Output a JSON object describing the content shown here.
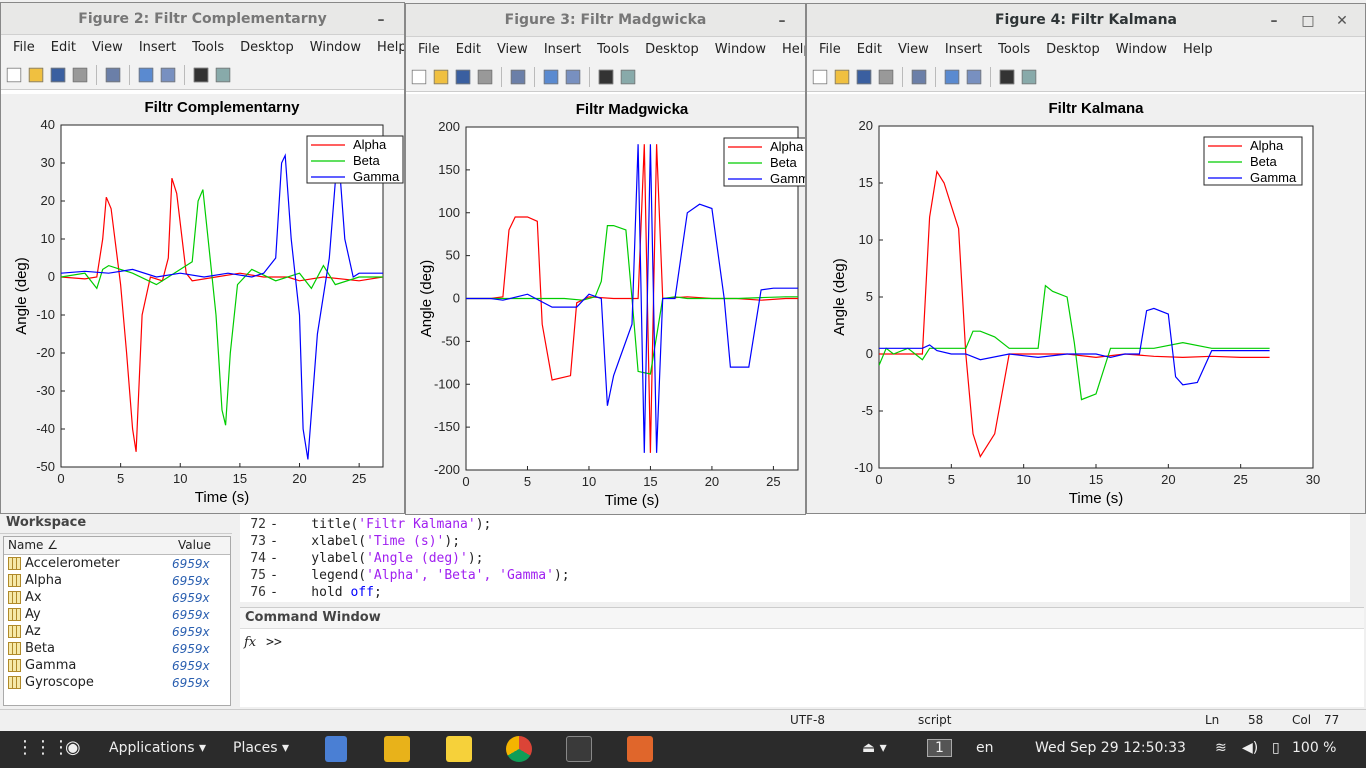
{
  "figures": [
    {
      "id": "fig2",
      "window_title": "Figure 2: Filtr Complementarny",
      "menu": [
        "File",
        "Edit",
        "View",
        "Insert",
        "Tools",
        "Desktop",
        "Window",
        "Help"
      ],
      "chart_data": {
        "type": "line",
        "title": "Filtr Complementarny",
        "xlabel": "Time (s)",
        "ylabel": "Angle (deg)",
        "xlim": [
          0,
          27
        ],
        "ylim": [
          -50,
          40
        ],
        "xticks": [
          0,
          5,
          10,
          15,
          20,
          25
        ],
        "yticks": [
          40,
          30,
          20,
          10,
          0,
          -10,
          -20,
          -30,
          -40,
          -50
        ],
        "legend": "top-right",
        "series": [
          {
            "name": "Alpha",
            "color": "#ff0000",
            "x": [
              0,
              2,
              3,
              3.5,
              3.8,
              4.2,
              5,
              5.5,
              6,
              6.3,
              6.8,
              7.5,
              8.5,
              9,
              9.3,
              9.7,
              10.5,
              11,
              13,
              15,
              17,
              19,
              20,
              22,
              25,
              27
            ],
            "y": [
              0,
              -0.5,
              0,
              10,
              21,
              18,
              -2,
              -20,
              -40,
              -46,
              -10,
              0,
              -1,
              5,
              26,
              22,
              1,
              -1,
              0,
              1,
              0,
              0,
              -1,
              0,
              -1,
              0
            ]
          },
          {
            "name": "Beta",
            "color": "#00cc00",
            "x": [
              0,
              2,
              3,
              3.5,
              4,
              5,
              6,
              8,
              10,
              11,
              11.5,
              11.9,
              12.5,
              13,
              13.5,
              13.8,
              14.2,
              14.8,
              16,
              18,
              20,
              21,
              22,
              23,
              25,
              27
            ],
            "y": [
              0,
              1,
              -3,
              2,
              3,
              2,
              1,
              -2,
              2,
              4,
              20,
              23,
              5,
              -10,
              -35,
              -39,
              -20,
              -2,
              2,
              -1,
              1,
              -3,
              3,
              -2,
              0,
              0
            ]
          },
          {
            "name": "Gamma",
            "color": "#0000ff",
            "x": [
              0,
              2,
              4,
              6,
              8,
              10,
              12,
              14,
              16,
              17,
              18,
              18.5,
              18.8,
              19.3,
              20,
              20.3,
              20.7,
              21.5,
              22.5,
              23,
              23.3,
              23.8,
              24.5,
              25,
              27
            ],
            "y": [
              1,
              1.5,
              1,
              2,
              0,
              1,
              0,
              1,
              0,
              1,
              5,
              30,
              32,
              10,
              -10,
              -40,
              -48,
              -15,
              5,
              25,
              31,
              10,
              0,
              1,
              1
            ]
          }
        ]
      }
    },
    {
      "id": "fig3",
      "window_title": "Figure 3: Filtr Madgwicka",
      "menu": [
        "File",
        "Edit",
        "View",
        "Insert",
        "Tools",
        "Desktop",
        "Window",
        "Help"
      ],
      "chart_data": {
        "type": "line",
        "title": "Filtr Madgwicka",
        "xlabel": "Time (s)",
        "ylabel": "Angle (deg)",
        "xlim": [
          0,
          27
        ],
        "ylim": [
          -200,
          200
        ],
        "xticks": [
          0,
          5,
          10,
          15,
          20,
          25
        ],
        "yticks": [
          200,
          150,
          100,
          50,
          0,
          -50,
          -100,
          -150,
          -200
        ],
        "legend": "top-right",
        "series": [
          {
            "name": "Alpha",
            "color": "#ff0000",
            "x": [
              0,
              2,
              3,
              3.5,
              4,
              5,
              5.8,
              6.2,
              7,
              8.5,
              9,
              10,
              12,
              14,
              14.5,
              15,
              15.5,
              16,
              18,
              20,
              22,
              24,
              26,
              27
            ],
            "y": [
              0,
              0,
              2,
              80,
              95,
              95,
              90,
              -30,
              -95,
              -90,
              -5,
              2,
              0,
              0,
              180,
              -180,
              180,
              0,
              2,
              0,
              0,
              -2,
              0,
              0
            ]
          },
          {
            "name": "Beta",
            "color": "#00cc00",
            "x": [
              0,
              2,
              4,
              6,
              8,
              9.5,
              10.5,
              11,
              11.5,
              12,
              13,
              13.5,
              14,
              15,
              16,
              17,
              18,
              20,
              22,
              24,
              26,
              27
            ],
            "y": [
              0,
              0,
              0,
              0,
              0,
              -2,
              2,
              20,
              85,
              85,
              80,
              0,
              -85,
              -88,
              0,
              2,
              0,
              0,
              0,
              1,
              2,
              2
            ]
          },
          {
            "name": "Gamma",
            "color": "#0000ff",
            "x": [
              0,
              2,
              3,
              5,
              7,
              9,
              10,
              11,
              11.5,
              12,
              12.5,
              13.5,
              14,
              14.5,
              15,
              15.5,
              16,
              17,
              18,
              19,
              20,
              21,
              21.5,
              22,
              23,
              24,
              25,
              27
            ],
            "y": [
              0,
              0,
              -2,
              5,
              -10,
              -10,
              5,
              0,
              -125,
              -90,
              -70,
              -30,
              180,
              -180,
              180,
              -180,
              0,
              0,
              100,
              110,
              105,
              0,
              -80,
              -80,
              -80,
              10,
              12,
              12
            ]
          }
        ]
      }
    },
    {
      "id": "fig4",
      "window_title": "Figure 4: Filtr Kalmana",
      "menu": [
        "File",
        "Edit",
        "View",
        "Insert",
        "Tools",
        "Desktop",
        "Window",
        "Help"
      ],
      "chart_data": {
        "type": "line",
        "title": "Filtr Kalmana",
        "xlabel": "Time (s)",
        "ylabel": "Angle (deg)",
        "xlim": [
          0,
          30
        ],
        "ylim": [
          -10,
          20
        ],
        "xticks": [
          0,
          5,
          10,
          15,
          20,
          25,
          30
        ],
        "yticks": [
          20,
          15,
          10,
          5,
          0,
          -5,
          -10
        ],
        "legend": "top-right",
        "series": [
          {
            "name": "Alpha",
            "color": "#ff0000",
            "x": [
              0,
              2,
              3,
              3.5,
              4,
              4.5,
              5,
              5.5,
              6,
              6.5,
              7,
              8,
              9,
              9.5,
              11,
              13,
              15,
              17,
              19,
              21,
              23,
              25,
              27
            ],
            "y": [
              0,
              0,
              0,
              12,
              16,
              15,
              13,
              11,
              0,
              -7,
              -9,
              -7,
              0,
              0,
              0,
              0,
              -0.3,
              0,
              -0.2,
              -0.3,
              -0.2,
              -0.3,
              -0.3
            ]
          },
          {
            "name": "Beta",
            "color": "#00cc00",
            "x": [
              0,
              0.5,
              1,
              2,
              3,
              3.5,
              4,
              5,
              6,
              6.5,
              7,
              8,
              9,
              10,
              11,
              11.5,
              12,
              13,
              13.5,
              14,
              15,
              16,
              17,
              19,
              21,
              23,
              25,
              27
            ],
            "y": [
              -1,
              0.5,
              0,
              0.5,
              -0.5,
              0.5,
              0.5,
              0.5,
              0.5,
              2,
              2,
              1.5,
              0.5,
              0.5,
              0.5,
              6,
              5.5,
              5,
              1,
              -4,
              -3.5,
              0.5,
              0.5,
              0.5,
              1,
              0.5,
              0.5,
              0.5
            ]
          },
          {
            "name": "Gamma",
            "color": "#0000ff",
            "x": [
              0,
              1,
              2,
              3,
              3.5,
              4,
              5,
              6,
              7,
              9,
              11,
              13,
              15,
              16,
              17,
              18,
              18.5,
              19,
              20,
              20.5,
              21,
              22,
              23,
              25,
              27
            ],
            "y": [
              0.5,
              0.5,
              0.5,
              0.5,
              0.8,
              0.3,
              0,
              0,
              -0.5,
              0,
              -0.3,
              0,
              0,
              -0.3,
              0,
              0,
              3.8,
              4,
              3.5,
              -2,
              -2.7,
              -2.5,
              0.3,
              0.3,
              0.3
            ]
          }
        ]
      }
    }
  ],
  "workspace": {
    "title": "Workspace",
    "col_name": "Name ∠",
    "col_value": "Value",
    "rows": [
      {
        "name": "Accelerometer",
        "value": "6959x"
      },
      {
        "name": "Alpha",
        "value": "6959x"
      },
      {
        "name": "Ax",
        "value": "6959x"
      },
      {
        "name": "Ay",
        "value": "6959x"
      },
      {
        "name": "Az",
        "value": "6959x"
      },
      {
        "name": "Beta",
        "value": "6959x"
      },
      {
        "name": "Gamma",
        "value": "6959x"
      },
      {
        "name": "Gyroscope",
        "value": "6959x"
      }
    ]
  },
  "editor": {
    "lines": [
      {
        "num": "72",
        "pre": "    title(",
        "str": "'Filtr Kalmana'",
        "post": ");"
      },
      {
        "num": "73",
        "pre": "    xlabel(",
        "str": "'Time (s)'",
        "post": ");"
      },
      {
        "num": "74",
        "pre": "    ylabel(",
        "str": "'Angle (deg)'",
        "post": ");"
      },
      {
        "num": "75",
        "pre": "    legend(",
        "str": "'Alpha', 'Beta', 'Gamma'",
        "post": ");"
      },
      {
        "num": "76",
        "pre": "    hold ",
        "str": "off",
        "post": ";"
      }
    ]
  },
  "command_window": {
    "title": "Command Window",
    "fx": "fx",
    "prompt": ">>"
  },
  "status": {
    "encoding": "UTF-8",
    "type": "script",
    "ln_label": "Ln",
    "ln": "58",
    "col_label": "Col",
    "col": "77"
  },
  "taskbar": {
    "applications": "Applications ▾",
    "places": "Places ▾",
    "workspace_num": "1",
    "lang": "en",
    "clock": "Wed Sep 29  12:50:33",
    "battery": "100 %"
  }
}
